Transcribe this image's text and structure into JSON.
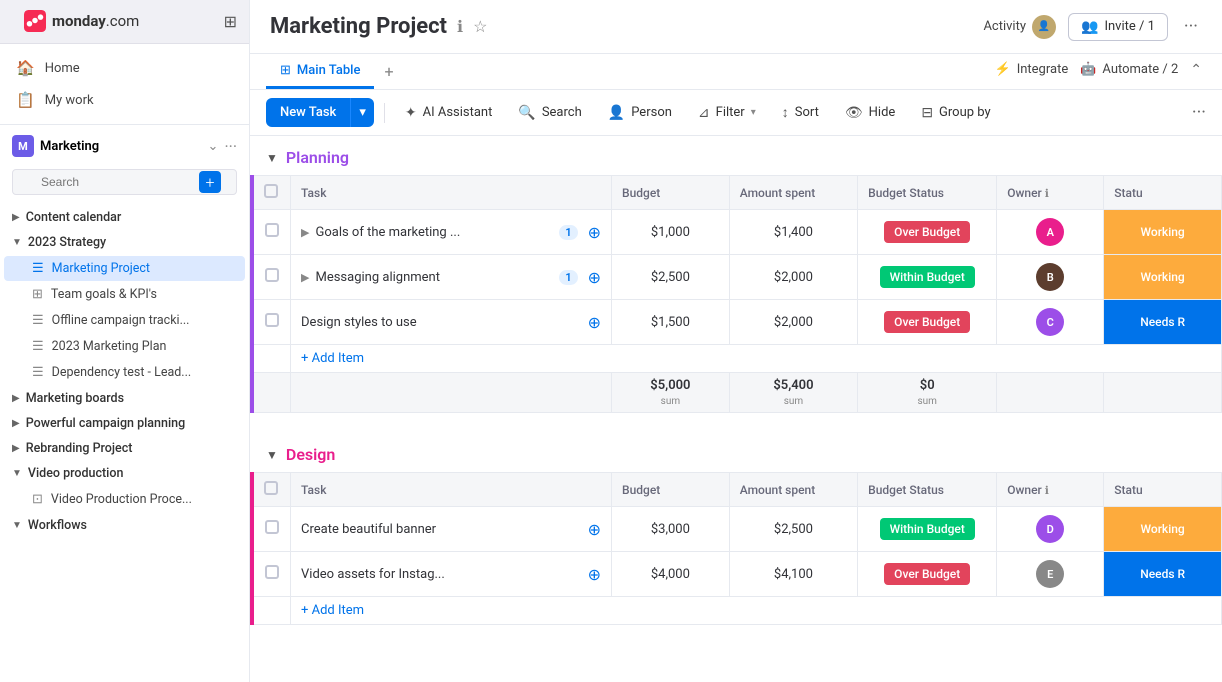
{
  "app": {
    "name": "monday",
    "domain": ".com"
  },
  "sidebar": {
    "nav_items": [
      {
        "id": "home",
        "label": "Home",
        "icon": "🏠"
      },
      {
        "id": "my-work",
        "label": "My work",
        "icon": "📋"
      }
    ],
    "workspace": {
      "name": "Marketing",
      "icon_letter": "M",
      "icon_color": "#6c5ce7"
    },
    "search_placeholder": "Search",
    "groups": [
      {
        "id": "content-calendar",
        "label": "Content calendar",
        "collapsed": true,
        "items": []
      },
      {
        "id": "2023-strategy",
        "label": "2023 Strategy",
        "collapsed": false,
        "items": [
          {
            "id": "marketing-project",
            "label": "Marketing Project",
            "icon": "☰",
            "active": true
          },
          {
            "id": "team-goals",
            "label": "Team goals & KPI's",
            "icon": "⊞"
          },
          {
            "id": "offline-campaign",
            "label": "Offline campaign tracki...",
            "icon": "☰"
          },
          {
            "id": "2023-marketing-plan",
            "label": "2023 Marketing Plan",
            "icon": "☰"
          },
          {
            "id": "dependency-test",
            "label": "Dependency test - Lead...",
            "icon": "☰"
          }
        ]
      },
      {
        "id": "marketing-boards",
        "label": "Marketing boards",
        "collapsed": true,
        "items": []
      },
      {
        "id": "powerful-campaign",
        "label": "Powerful campaign planning",
        "collapsed": true,
        "items": []
      },
      {
        "id": "rebranding",
        "label": "Rebranding Project",
        "collapsed": true,
        "items": []
      },
      {
        "id": "video-production",
        "label": "Video production",
        "collapsed": false,
        "items": [
          {
            "id": "video-production-proc",
            "label": "Video Production Proce...",
            "icon": "⊡"
          }
        ]
      },
      {
        "id": "workflows",
        "label": "Workflows",
        "collapsed": true,
        "items": []
      }
    ]
  },
  "header": {
    "project_title": "Marketing Project",
    "activity_label": "Activity",
    "invite_label": "Invite / 1",
    "tabs": [
      {
        "id": "main-table",
        "label": "Main Table",
        "icon": "⊞",
        "active": true
      }
    ],
    "tab_add_label": "+",
    "integrate_label": "Integrate",
    "automate_label": "Automate / 2"
  },
  "toolbar": {
    "new_task_label": "New Task",
    "ai_assistant_label": "AI Assistant",
    "search_label": "Search",
    "person_label": "Person",
    "filter_label": "Filter",
    "sort_label": "Sort",
    "hide_label": "Hide",
    "group_by_label": "Group by"
  },
  "planning_group": {
    "title": "Planning",
    "color": "#9c4ee8",
    "columns": [
      "Task",
      "Budget",
      "Amount spent",
      "Budget Status",
      "Owner",
      "Statu"
    ],
    "rows": [
      {
        "task": "Goals of the marketing ...",
        "badge": "1",
        "budget": "$1,000",
        "spent": "$1,400",
        "budget_status": "Over Budget",
        "budget_status_type": "over",
        "owner_color": "#e91e8c",
        "owner_letter": "A",
        "status": "Working",
        "status_type": "working"
      },
      {
        "task": "Messaging alignment",
        "badge": "1",
        "budget": "$2,500",
        "spent": "$2,000",
        "budget_status": "Within Budget",
        "budget_status_type": "within",
        "owner_color": "#5c3d2e",
        "owner_letter": "B",
        "status": "Working",
        "status_type": "working"
      },
      {
        "task": "Design styles to use",
        "badge": "",
        "budget": "$1,500",
        "spent": "$2,000",
        "budget_status": "Over Budget",
        "budget_status_type": "over",
        "owner_color": "#9c4ee8",
        "owner_letter": "C",
        "status": "Needs R",
        "status_type": "needs"
      }
    ],
    "add_item_label": "+ Add Item",
    "sum_budget": "$5,000",
    "sum_spent": "$5,400",
    "sum_zero": "$0"
  },
  "design_group": {
    "title": "Design",
    "color": "#e91e8c",
    "columns": [
      "Task",
      "Budget",
      "Amount spent",
      "Budget Status",
      "Owner",
      "Statu"
    ],
    "rows": [
      {
        "task": "Create beautiful banner",
        "badge": "",
        "budget": "$3,000",
        "spent": "$2,500",
        "budget_status": "Within Budget",
        "budget_status_type": "within",
        "owner_color": "#9c4ee8",
        "owner_letter": "D",
        "status": "Working",
        "status_type": "working"
      },
      {
        "task": "Video assets for Instag...",
        "badge": "",
        "budget": "$4,000",
        "spent": "$4,100",
        "budget_status": "Over Budget",
        "budget_status_type": "over",
        "owner_color": "#888",
        "owner_letter": "E",
        "status": "Needs R",
        "status_type": "needs"
      }
    ],
    "add_item_label": "+ Add Item"
  }
}
